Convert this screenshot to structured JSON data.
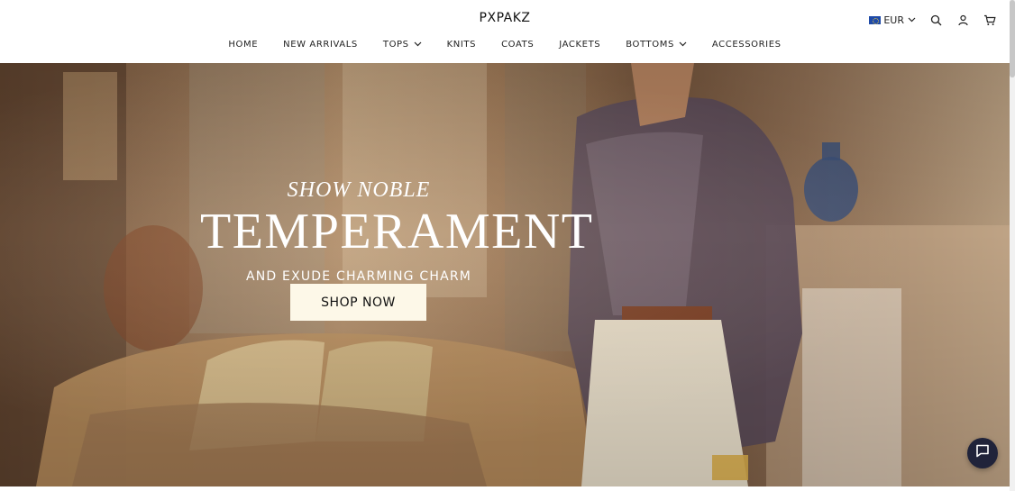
{
  "header": {
    "logo": "PXPAKZ",
    "currency": {
      "label": "EUR",
      "flag_icon": "eu-flag-icon"
    },
    "icons": [
      "search-icon",
      "user-icon",
      "cart-icon"
    ]
  },
  "nav": {
    "items": [
      {
        "label": "HOME",
        "dropdown": false
      },
      {
        "label": "NEW ARRIVALS",
        "dropdown": false
      },
      {
        "label": "TOPS",
        "dropdown": true
      },
      {
        "label": "KNITS",
        "dropdown": false
      },
      {
        "label": "COATS",
        "dropdown": false
      },
      {
        "label": "JACKETS",
        "dropdown": false
      },
      {
        "label": "BOTTOMS",
        "dropdown": true
      },
      {
        "label": "ACCESSORIES",
        "dropdown": false
      }
    ]
  },
  "hero": {
    "kicker": "SHOW NOBLE",
    "headline": "TEMPERAMENT",
    "subheadline": "AND EXUDE CHARMING CHARM",
    "cta_label": "SHOP NOW"
  },
  "chat": {
    "icon": "chat-icon"
  },
  "colors": {
    "cta_background": "#fdf8e8",
    "chat_background": "#20233a",
    "hero_text": "#ffffff"
  }
}
